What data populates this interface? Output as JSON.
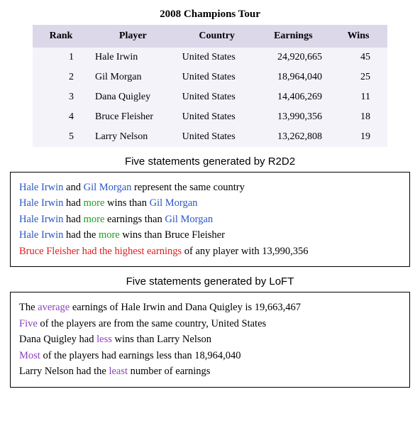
{
  "title": "2008 Champions Tour",
  "table": {
    "headers": [
      "Rank",
      "Player",
      "Country",
      "Earnings",
      "Wins"
    ],
    "rows": [
      {
        "rank": "1",
        "player": "Hale Irwin",
        "country": "United States",
        "earnings": "24,920,665",
        "wins": "45"
      },
      {
        "rank": "2",
        "player": "Gil Morgan",
        "country": "United States",
        "earnings": "18,964,040",
        "wins": "25"
      },
      {
        "rank": "3",
        "player": "Dana Quigley",
        "country": "United States",
        "earnings": "14,406,269",
        "wins": "11"
      },
      {
        "rank": "4",
        "player": "Bruce Fleisher",
        "country": "United States",
        "earnings": "13,990,356",
        "wins": "18"
      },
      {
        "rank": "5",
        "player": "Larry Nelson",
        "country": "United States",
        "earnings": "13,262,808",
        "wins": "19"
      }
    ]
  },
  "sections": [
    {
      "caption": "Five statements generated by R2D2",
      "statements": [
        [
          {
            "t": "Hale Irwin",
            "c": "blue"
          },
          {
            "t": " and "
          },
          {
            "t": "Gil Morgan",
            "c": "blue"
          },
          {
            "t": " represent the same country"
          }
        ],
        [
          {
            "t": "Hale Irwin",
            "c": "blue"
          },
          {
            "t": " had "
          },
          {
            "t": "more",
            "c": "green"
          },
          {
            "t": " wins than "
          },
          {
            "t": "Gil Morgan",
            "c": "blue"
          }
        ],
        [
          {
            "t": "Hale Irwin",
            "c": "blue"
          },
          {
            "t": " had "
          },
          {
            "t": "more",
            "c": "green"
          },
          {
            "t": " earnings than "
          },
          {
            "t": "Gil Morgan",
            "c": "blue"
          }
        ],
        [
          {
            "t": "Hale Irwin",
            "c": "blue"
          },
          {
            "t": " had the "
          },
          {
            "t": "more",
            "c": "green"
          },
          {
            "t": " wins than Bruce Fleisher"
          }
        ],
        [
          {
            "t": "Bruce Fleisher had the highest earnings",
            "c": "red"
          },
          {
            "t": " of any player with 13,990,356"
          }
        ]
      ]
    },
    {
      "caption": "Five statements generated by LoFT",
      "statements": [
        [
          {
            "t": "The "
          },
          {
            "t": "average",
            "c": "purple"
          },
          {
            "t": " earnings of Hale Irwin and Dana Quigley is 19,663,467"
          }
        ],
        [
          {
            "t": "Five",
            "c": "purple"
          },
          {
            "t": " of the players are from the same country, United States"
          }
        ],
        [
          {
            "t": "Dana Quigley had "
          },
          {
            "t": "less",
            "c": "purple"
          },
          {
            "t": " wins than Larry Nelson"
          }
        ],
        [
          {
            "t": "Most",
            "c": "purple"
          },
          {
            "t": " of the players had earnings less than 18,964,040"
          }
        ],
        [
          {
            "t": "Larry Nelson had the "
          },
          {
            "t": "least",
            "c": "purple"
          },
          {
            "t": " number of earnings"
          }
        ]
      ]
    }
  ],
  "chart_data": {
    "type": "table",
    "title": "2008 Champions Tour",
    "columns": [
      "Rank",
      "Player",
      "Country",
      "Earnings",
      "Wins"
    ],
    "rows": [
      [
        1,
        "Hale Irwin",
        "United States",
        24920665,
        45
      ],
      [
        2,
        "Gil Morgan",
        "United States",
        18964040,
        25
      ],
      [
        3,
        "Dana Quigley",
        "United States",
        14406269,
        11
      ],
      [
        4,
        "Bruce Fleisher",
        "United States",
        13990356,
        18
      ],
      [
        5,
        "Larry Nelson",
        "United States",
        13262808,
        19
      ]
    ]
  }
}
